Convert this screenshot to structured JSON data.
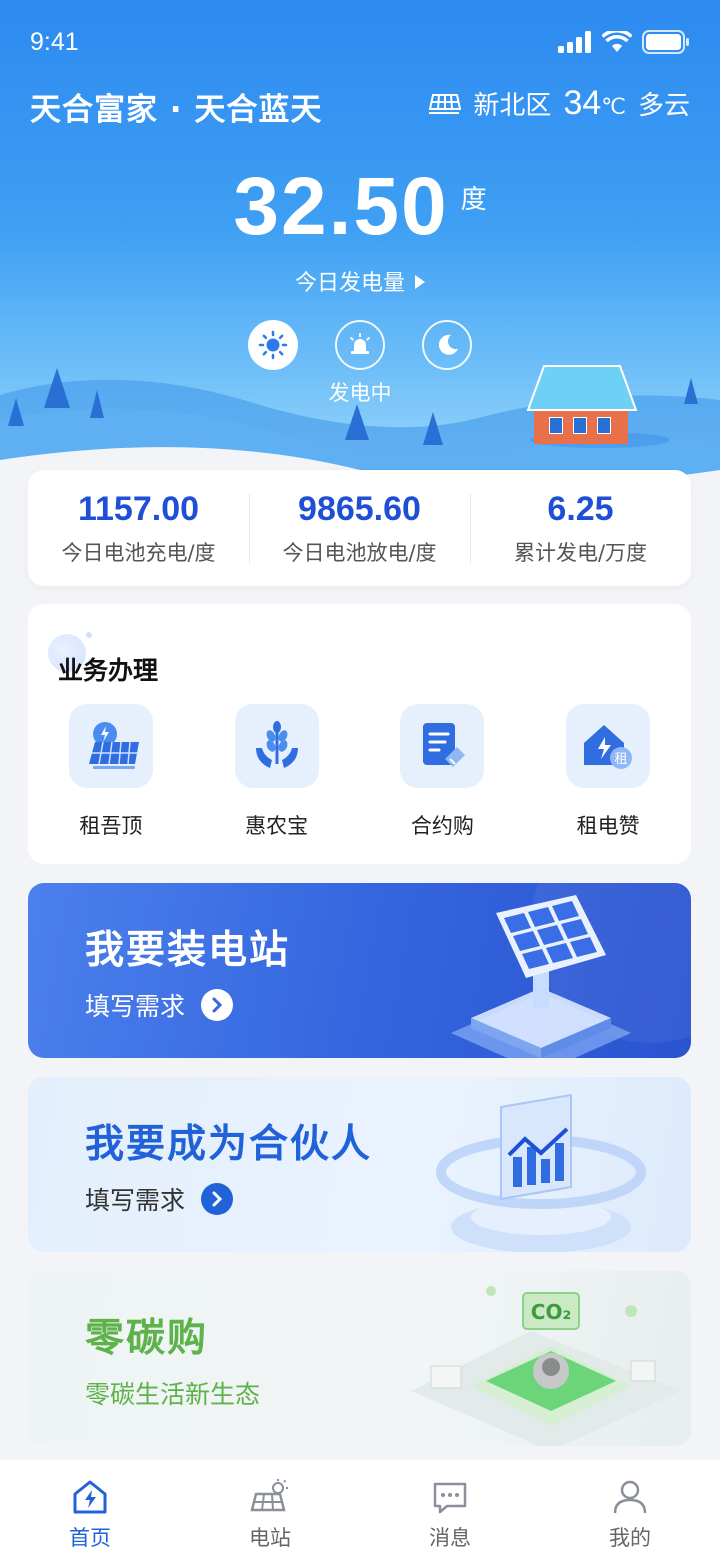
{
  "status_bar": {
    "time": "9:41"
  },
  "header": {
    "station_name": "天合富家 · 天合蓝天",
    "district": "新北区",
    "temperature": "34",
    "temperature_unit": "℃",
    "weather": "多云"
  },
  "generation": {
    "value": "32.50",
    "unit": "度",
    "label": "今日发电量",
    "status": "发电中",
    "modes": [
      "sun-icon",
      "alarm-icon",
      "moon-icon"
    ]
  },
  "stats": [
    {
      "value": "1157.00",
      "label": "今日电池充电/度"
    },
    {
      "value": "9865.60",
      "label": "今日电池放电/度"
    },
    {
      "value": "6.25",
      "label": "累计发电/万度"
    }
  ],
  "services": {
    "title": "业务办理",
    "items": [
      {
        "label": "租吾顶",
        "icon": "solar-panel-icon"
      },
      {
        "label": "惠农宝",
        "icon": "wheat-hands-icon"
      },
      {
        "label": "合约购",
        "icon": "contract-icon"
      },
      {
        "label": "租电赞",
        "icon": "house-rent-icon",
        "badge": "租"
      }
    ]
  },
  "banners": [
    {
      "title": "我要装电站",
      "sub": "填写需求"
    },
    {
      "title": "我要成为合伙人",
      "sub": "填写需求"
    },
    {
      "title": "零碳购",
      "sub": "零碳生活新生态",
      "art_text": "CO₂"
    }
  ],
  "tabbar": [
    {
      "label": "首页",
      "active": true
    },
    {
      "label": "电站",
      "active": false
    },
    {
      "label": "消息",
      "active": false
    },
    {
      "label": "我的",
      "active": false
    }
  ],
  "colors": {
    "primary": "#2262d8",
    "stat_value": "#1f4fd6",
    "green": "#5db24a",
    "hero_top": "#2d8af0"
  }
}
